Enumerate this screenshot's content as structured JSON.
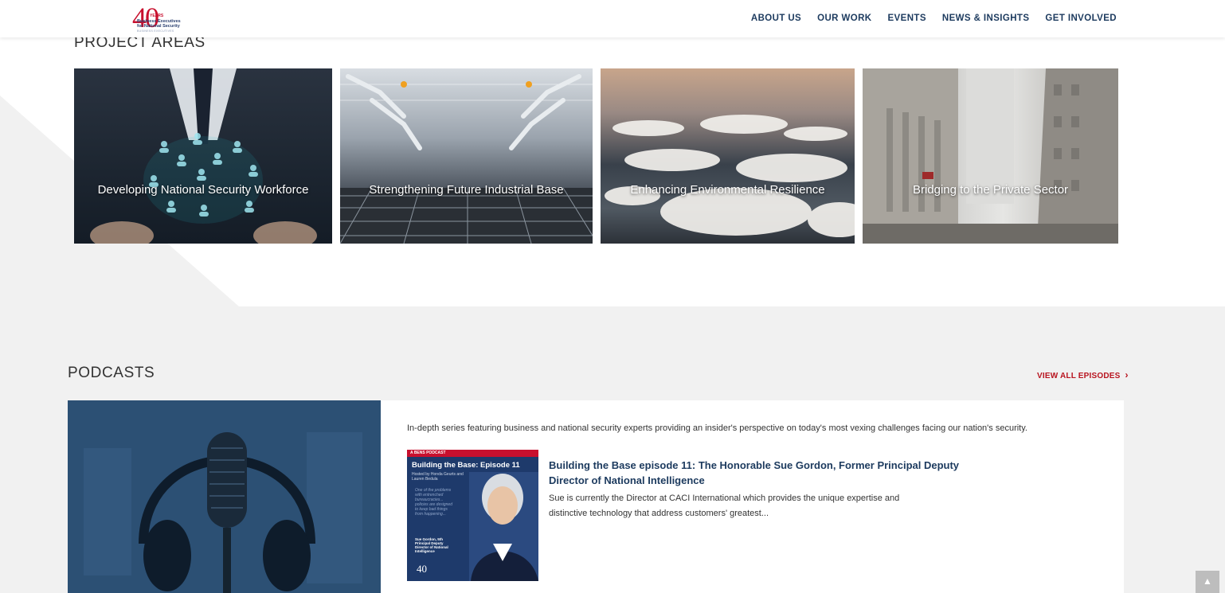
{
  "header": {
    "logo": {
      "number": "40",
      "years": "YEARS",
      "line1": "Business Executives",
      "line2": "for National Security",
      "tagline": "BUSINESS EXECUTIVES"
    },
    "nav": [
      {
        "label": "ABOUT US"
      },
      {
        "label": "OUR WORK"
      },
      {
        "label": "EVENTS"
      },
      {
        "label": "NEWS & INSIGHTS"
      },
      {
        "label": "GET INVOLVED"
      }
    ]
  },
  "project_areas": {
    "title": "PROJECT AREAS",
    "cards": [
      {
        "label": "Developing National Security Workforce"
      },
      {
        "label": "Strengthening Future Industrial Base"
      },
      {
        "label": "Enhancing Environmental Resilience"
      },
      {
        "label": "Bridging to the Private Sector"
      }
    ]
  },
  "podcasts": {
    "title": "PODCASTS",
    "view_all": "VIEW ALL EPISODES",
    "description": "In-depth series featuring business and national security experts providing an insider's perspective on today's most vexing challenges facing our nation's security.",
    "episode": {
      "thumb_band": "A BENS PODCAST",
      "thumb_title": "Building the Base: Episode 11",
      "thumb_hosts": "Hosted by Honda Geurts and Lauren Bedula",
      "thumb_quote": "One of the problems with entrenched bureaucracies... policies are designed to keep bad things from happening...",
      "thumb_guest": "Sue Gordon, 5th Principal Deputy Director of National Intelligence",
      "thumb_logo": "40",
      "title": "Building the Base episode 11: The Honorable Sue Gordon, Former Principal Deputy Director of National Intelligence",
      "excerpt": "Sue is currently the Director at CACI International which provides the unique expertise and distinctive technology that address customers' greatest..."
    }
  },
  "colors": {
    "navy": "#1c3a5e",
    "red": "#b8141f",
    "grey_bg": "#f1f1f1"
  }
}
